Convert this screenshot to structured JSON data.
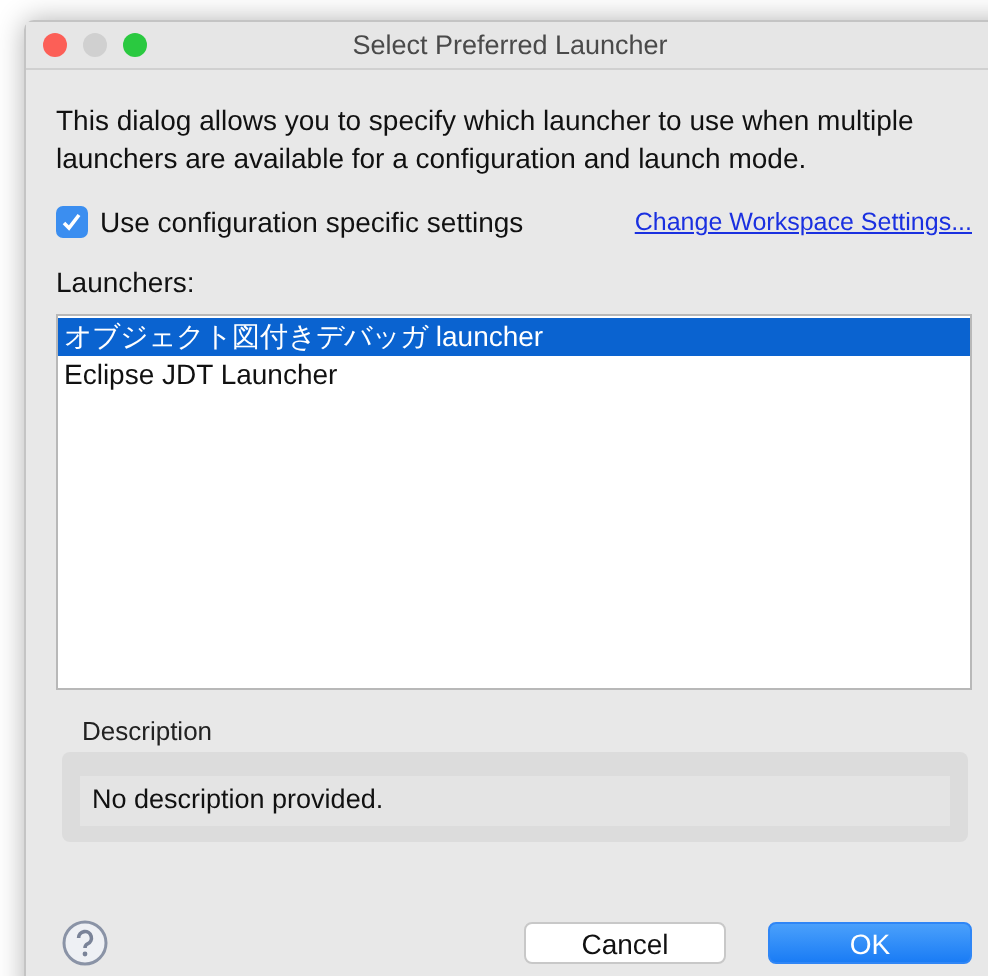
{
  "window": {
    "title": "Select Preferred Launcher"
  },
  "intro": "This dialog allows you to specify which launcher to use when multiple launchers are available for a configuration and launch mode.",
  "use_specific": {
    "label": "Use configuration specific settings",
    "checked": true
  },
  "workspace_link": "Change Workspace Settings...",
  "launchers": {
    "label": "Launchers:",
    "items": [
      {
        "label": "オブジェクト図付きデバッガ launcher",
        "selected": true
      },
      {
        "label": "Eclipse JDT Launcher",
        "selected": false
      }
    ]
  },
  "description": {
    "label": "Description",
    "text": "No description provided."
  },
  "buttons": [
    {
      "label": "Cancel",
      "kind": "cancel"
    },
    {
      "label": "OK",
      "kind": "default"
    }
  ]
}
